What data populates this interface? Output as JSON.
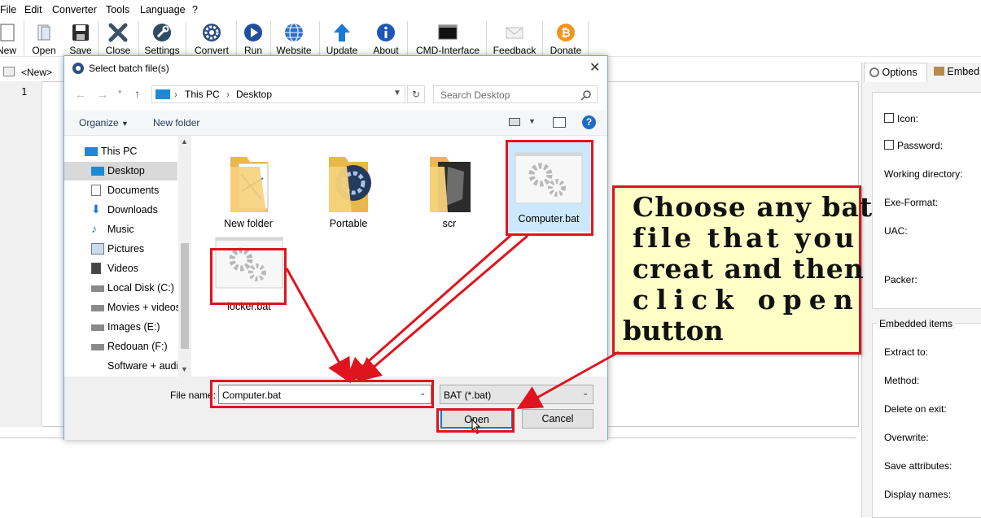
{
  "menu": [
    "File",
    "Edit",
    "Converter",
    "Tools",
    "Language",
    "?"
  ],
  "toolbar": [
    {
      "label": "New",
      "icon": "new-document-icon"
    },
    {
      "label": "Open",
      "icon": "open-file-icon"
    },
    {
      "label": "Save",
      "icon": "floppy-disk-icon"
    },
    {
      "label": "Close",
      "icon": "close-x-icon"
    },
    {
      "label": "Settings",
      "icon": "wrench-icon"
    },
    {
      "label": "Convert",
      "icon": "gear-icon"
    },
    {
      "label": "Run",
      "icon": "play-icon"
    },
    {
      "label": "Website",
      "icon": "globe-icon"
    },
    {
      "label": "Update",
      "icon": "up-arrow-icon"
    },
    {
      "label": "About",
      "icon": "info-icon"
    },
    {
      "label": "CMD-Interface",
      "icon": "terminal-icon"
    },
    {
      "label": "Feedback",
      "icon": "envelope-icon"
    },
    {
      "label": "Donate",
      "icon": "bitcoin-icon"
    }
  ],
  "editor": {
    "tab": "<New>",
    "line_number": "1"
  },
  "right_panel": {
    "tabs": [
      "Options",
      "Embed"
    ],
    "options": [
      "Icon:",
      "Password:",
      "Working directory:",
      "Exe-Format:",
      "UAC:",
      "Packer:"
    ],
    "embedded_title": "Embedded items",
    "embedded": [
      "Extract to:",
      "Method:",
      "Delete on exit:",
      "Overwrite:",
      "Save attributes:",
      "Display names:"
    ]
  },
  "dialog": {
    "title": "Select batch file(s)",
    "breadcrumb": [
      "This PC",
      "Desktop"
    ],
    "search_placeholder": "Search Desktop",
    "organize": "Organize",
    "new_folder": "New folder",
    "nav": [
      "This PC",
      "Desktop",
      "Documents",
      "Downloads",
      "Music",
      "Pictures",
      "Videos",
      "Local Disk (C:)",
      "Movies + videos",
      "Images (E:)",
      "Redouan (F:)",
      "Software + audio"
    ],
    "files": [
      "New folder",
      "Portable",
      "scr",
      "Computer.bat",
      "locker.bat"
    ],
    "file_name_label": "File name:",
    "file_name_value": "Computer.bat",
    "file_type": "BAT (*.bat)",
    "open": "Open",
    "cancel": "Cancel"
  },
  "callout": [
    "Choose any bat",
    "file that you",
    "creat and then",
    "click open",
    "button"
  ],
  "colors": {
    "highlight": "#e0141e",
    "callout_bg": "#ffffc6",
    "accent": "#0078d7"
  }
}
